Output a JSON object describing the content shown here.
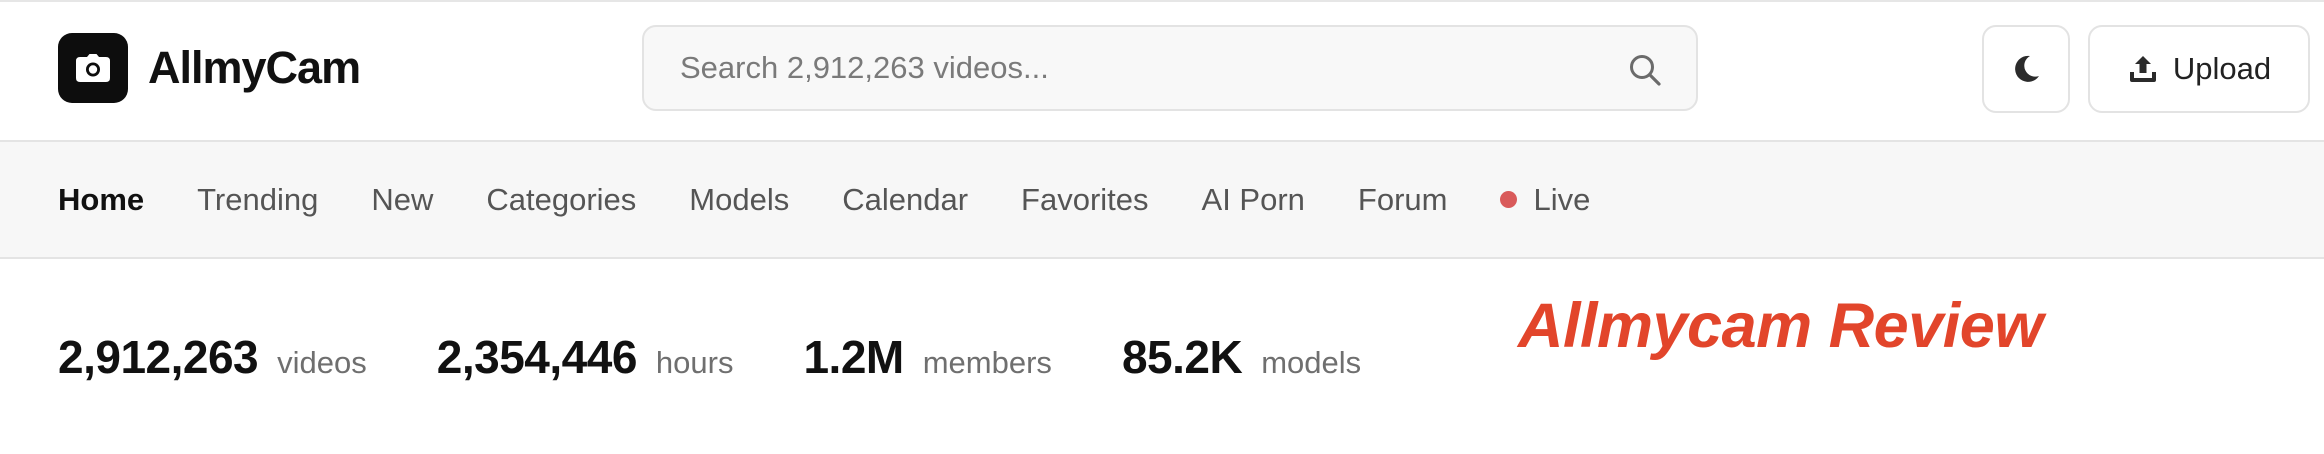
{
  "header": {
    "brand": "AllmyCam",
    "search_placeholder": "Search 2,912,263 videos...",
    "upload_label": "Upload"
  },
  "nav": {
    "items": [
      {
        "label": "Home",
        "active": true
      },
      {
        "label": "Trending"
      },
      {
        "label": "New"
      },
      {
        "label": "Categories"
      },
      {
        "label": "Models"
      },
      {
        "label": "Calendar"
      },
      {
        "label": "Favorites"
      },
      {
        "label": "AI Porn"
      },
      {
        "label": "Forum"
      },
      {
        "label": "Live"
      }
    ]
  },
  "stats": [
    {
      "value": "2,912,263",
      "label": "videos"
    },
    {
      "value": "2,354,446",
      "label": "hours"
    },
    {
      "value": "1.2M",
      "label": "members"
    },
    {
      "value": "85.2K",
      "label": "models"
    }
  ],
  "overlay": {
    "title": "Allmycam Review"
  },
  "icons": {
    "logo": "camera-icon",
    "search": "search-icon",
    "theme": "moon-icon",
    "upload": "upload-icon",
    "live": "live-dot-icon"
  },
  "colors": {
    "brand_dark": "#0d0d0d",
    "live_dot": "#d95a5a",
    "review_title": "#e2452b",
    "nav_background": "#f7f7f7"
  }
}
